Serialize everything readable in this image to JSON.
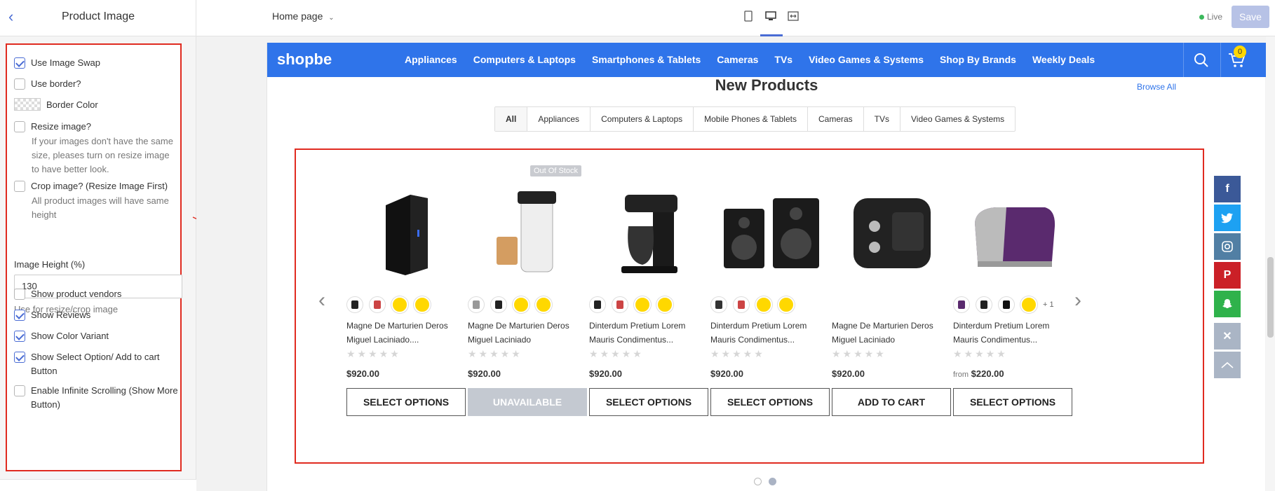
{
  "header": {
    "back_icon": "chevron-left-icon",
    "panel_title": "Product Image",
    "page_select": "Home page",
    "live_label": "Live",
    "save_label": "Save"
  },
  "settings": {
    "use_image_swap": {
      "label": "Use Image Swap",
      "checked": true
    },
    "use_border": {
      "label": "Use border?",
      "checked": false
    },
    "border_color": {
      "label": "Border Color"
    },
    "resize_image": {
      "label": "Resize image?",
      "checked": false,
      "help": "If your images don't have the same size, pleases turn on resize image to have better look."
    },
    "crop_image": {
      "label": "Crop image? (Resize Image First)",
      "checked": false,
      "help": "All product images will have same height"
    },
    "image_height": {
      "label": "Image Height (%)",
      "value": "130",
      "help": "Use for resize/crop image"
    },
    "show_vendors": {
      "label": "Show product vendors",
      "checked": false
    },
    "show_reviews": {
      "label": "Show Reviews",
      "checked": true
    },
    "show_color_variant": {
      "label": "Show Color Variant",
      "checked": true
    },
    "show_select_option": {
      "label": "Show Select Option/ Add to cart Button",
      "checked": true
    },
    "infinite_scrolling": {
      "label": "Enable Infinite Scrolling (Show More Button)",
      "checked": false
    }
  },
  "store": {
    "logo": "shopbe",
    "menu": [
      "Appliances",
      "Computers & Laptops",
      "Smartphones & Tablets",
      "Cameras",
      "TVs",
      "Video Games & Systems",
      "Shop By Brands",
      "Weekly Deals"
    ],
    "cart_count": "0",
    "section_title": "New Products",
    "browse_all": "Browse All",
    "tabs": [
      "All",
      "Appliances",
      "Computers & Laptops",
      "Mobile Phones & Tablets",
      "Cameras",
      "TVs",
      "Video Games & Systems"
    ],
    "products": [
      {
        "name": "Magne De Marturien Deros Miguel Laciniado....",
        "price": "$920.00",
        "price_prefix": "",
        "button": "SELECT OPTIONS",
        "badge": "",
        "more": ""
      },
      {
        "name": "Magne De Marturien Deros Miguel Laciniado",
        "price": "$920.00",
        "price_prefix": "",
        "button": "UNAVAILABLE",
        "badge": "Out Of Stock",
        "more": ""
      },
      {
        "name": "Dinterdum Pretium Lorem Mauris Condimentus...",
        "price": "$920.00",
        "price_prefix": "",
        "button": "SELECT OPTIONS",
        "badge": "",
        "more": ""
      },
      {
        "name": "Dinterdum Pretium Lorem Mauris Condimentus...",
        "price": "$920.00",
        "price_prefix": "",
        "button": "SELECT OPTIONS",
        "badge": "",
        "more": ""
      },
      {
        "name": "Magne De Marturien Deros Miguel Laciniado",
        "price": "$920.00",
        "price_prefix": "",
        "button": "ADD TO CART",
        "badge": "",
        "more": ""
      },
      {
        "name": "Dinterdum Pretium Lorem Mauris Condimentus...",
        "price": "$220.00",
        "price_prefix": "from",
        "button": "SELECT OPTIONS",
        "badge": "",
        "more": "+ 1"
      }
    ]
  },
  "social": [
    "facebook-icon",
    "twitter-icon",
    "instagram-icon",
    "pinterest-icon",
    "snapchat-icon",
    "close-icon",
    "chevron-up-icon"
  ],
  "colors": {
    "accent": "#4a6cd4",
    "nav": "#2f74ea",
    "highlight": "#e02b20",
    "badge": "#ffd800"
  }
}
